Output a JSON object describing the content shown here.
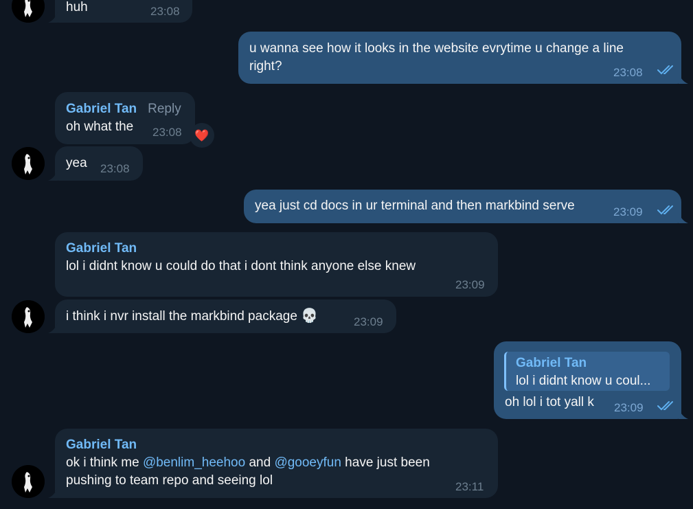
{
  "messages": {
    "m1": {
      "text": "huh",
      "time": "23:08"
    },
    "m2": {
      "text_line1": "u wanna see how it looks in the website evrytime u change a line",
      "text_line2": "right?",
      "time": "23:08"
    },
    "m3": {
      "sender": "Gabriel Tan",
      "reply_label": "Reply",
      "text": "oh what the",
      "time": "23:08",
      "reaction": "❤️"
    },
    "m4": {
      "text": "yea",
      "time": "23:08"
    },
    "m5": {
      "text": "yea just cd docs in ur terminal and then markbind serve",
      "time": "23:09"
    },
    "m6": {
      "sender": "Gabriel Tan",
      "text": "lol i didnt know u could do that i dont think anyone else knew",
      "time": "23:09"
    },
    "m7": {
      "text": "i think i nvr install the markbind package",
      "emoji": "💀",
      "time": "23:09"
    },
    "m8": {
      "quote_sender": "Gabriel Tan",
      "quote_text": "lol i didnt know u coul...",
      "text": "oh lol i tot yall k",
      "time": "23:09"
    },
    "m9": {
      "sender": "Gabriel Tan",
      "text_a": "ok i think me ",
      "mention1": "@benlim_heehoo",
      "text_b": " and ",
      "mention2": "@gooeyfun",
      "text_c": " have just been",
      "text_line2": "pushing to team repo and seeing lol",
      "time": "23:11"
    }
  },
  "colors": {
    "background": "#0e1621",
    "incoming_bubble": "#182533",
    "outgoing_bubble": "#2b5278",
    "sender_name": "#71baf7",
    "read_checks": "#5fb0f0"
  },
  "icons": {
    "read_receipt": "double-check-icon",
    "avatar": "user-avatar"
  }
}
